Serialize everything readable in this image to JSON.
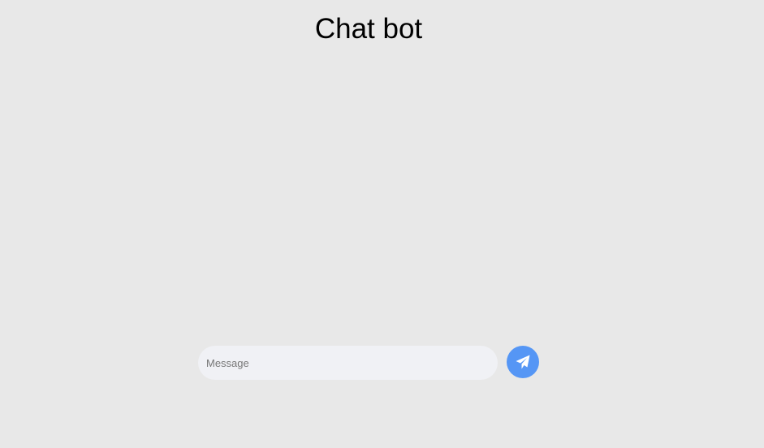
{
  "header": {
    "title": "Chat bot"
  },
  "composer": {
    "placeholder": "Message",
    "value": "",
    "send_icon": "paper-plane-icon"
  },
  "colors": {
    "background": "#e8e8e8",
    "input_background": "#f0f1f5",
    "accent": "#5596f5"
  }
}
